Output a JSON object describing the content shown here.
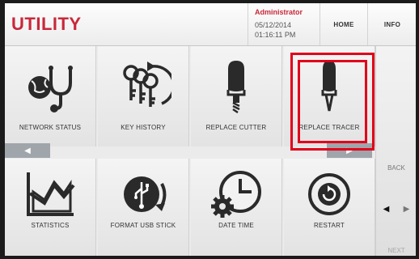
{
  "header": {
    "title": "UTILITY",
    "user": "Administrator",
    "date": "05/12/2014",
    "time": "01:16:11 PM",
    "home_label": "HOME",
    "info_label": "INFO"
  },
  "tiles": [
    {
      "label": "NETWORK STATUS",
      "icon": "network-status-icon"
    },
    {
      "label": "KEY HISTORY",
      "icon": "key-history-icon"
    },
    {
      "label": "REPLACE CUTTER",
      "icon": "replace-cutter-icon"
    },
    {
      "label": "REPLACE TRACER",
      "icon": "replace-tracer-icon"
    },
    {
      "label": "STATISTICS",
      "icon": "statistics-icon"
    },
    {
      "label": "FORMAT USB STICK",
      "icon": "format-usb-icon"
    },
    {
      "label": "DATE TIME",
      "icon": "date-time-icon"
    },
    {
      "label": "RESTART",
      "icon": "restart-icon"
    }
  ],
  "side": {
    "back_label": "BACK",
    "next_label": "NEXT"
  },
  "nav": {
    "prev_glyph": "◀",
    "next_glyph": "▶"
  },
  "colors": {
    "accent": "#c8283a",
    "highlight": "#e1001a",
    "icon": "#2a2a2a"
  }
}
